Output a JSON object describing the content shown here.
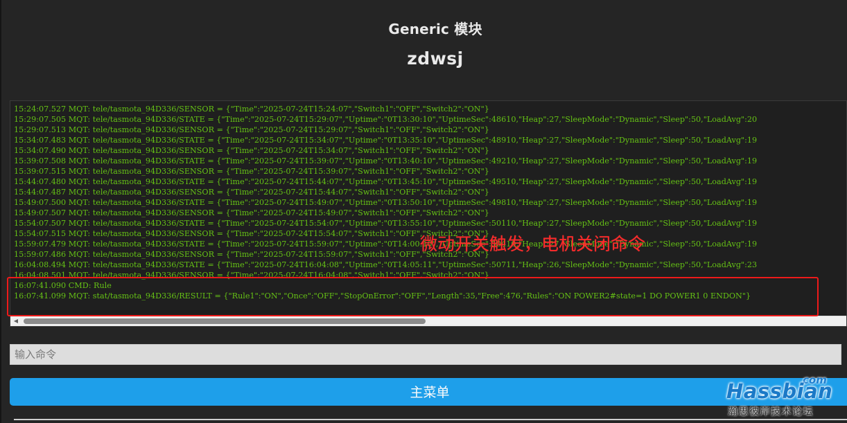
{
  "header": {
    "module_title": "Generic 模块",
    "device_name": "zdwsj"
  },
  "console": {
    "lines": [
      "15:24:07.527 MQT: tele/tasmota_94D336/SENSOR = {\"Time\":\"2025-07-24T15:24:07\",\"Switch1\":\"OFF\",\"Switch2\":\"ON\"}",
      "15:29:07.505 MQT: tele/tasmota_94D336/STATE = {\"Time\":\"2025-07-24T15:29:07\",\"Uptime\":\"0T13:30:10\",\"UptimeSec\":48610,\"Heap\":27,\"SleepMode\":\"Dynamic\",\"Sleep\":50,\"LoadAvg\":20",
      "15:29:07.513 MQT: tele/tasmota_94D336/SENSOR = {\"Time\":\"2025-07-24T15:29:07\",\"Switch1\":\"OFF\",\"Switch2\":\"ON\"}",
      "15:34:07.483 MQT: tele/tasmota_94D336/STATE = {\"Time\":\"2025-07-24T15:34:07\",\"Uptime\":\"0T13:35:10\",\"UptimeSec\":48910,\"Heap\":27,\"SleepMode\":\"Dynamic\",\"Sleep\":50,\"LoadAvg\":19",
      "15:34:07.490 MQT: tele/tasmota_94D336/SENSOR = {\"Time\":\"2025-07-24T15:34:07\",\"Switch1\":\"OFF\",\"Switch2\":\"ON\"}",
      "15:39:07.508 MQT: tele/tasmota_94D336/STATE = {\"Time\":\"2025-07-24T15:39:07\",\"Uptime\":\"0T13:40:10\",\"UptimeSec\":49210,\"Heap\":27,\"SleepMode\":\"Dynamic\",\"Sleep\":50,\"LoadAvg\":19",
      "15:39:07.515 MQT: tele/tasmota_94D336/SENSOR = {\"Time\":\"2025-07-24T15:39:07\",\"Switch1\":\"OFF\",\"Switch2\":\"ON\"}",
      "15:44:07.480 MQT: tele/tasmota_94D336/STATE = {\"Time\":\"2025-07-24T15:44:07\",\"Uptime\":\"0T13:45:10\",\"UptimeSec\":49510,\"Heap\":27,\"SleepMode\":\"Dynamic\",\"Sleep\":50,\"LoadAvg\":19",
      "15:44:07.487 MQT: tele/tasmota_94D336/SENSOR = {\"Time\":\"2025-07-24T15:44:07\",\"Switch1\":\"OFF\",\"Switch2\":\"ON\"}",
      "15:49:07.500 MQT: tele/tasmota_94D336/STATE = {\"Time\":\"2025-07-24T15:49:07\",\"Uptime\":\"0T13:50:10\",\"UptimeSec\":49810,\"Heap\":27,\"SleepMode\":\"Dynamic\",\"Sleep\":50,\"LoadAvg\":19",
      "15:49:07.507 MQT: tele/tasmota_94D336/SENSOR = {\"Time\":\"2025-07-24T15:49:07\",\"Switch1\":\"OFF\",\"Switch2\":\"ON\"}",
      "15:54:07.507 MQT: tele/tasmota_94D336/STATE = {\"Time\":\"2025-07-24T15:54:07\",\"Uptime\":\"0T13:55:10\",\"UptimeSec\":50110,\"Heap\":27,\"SleepMode\":\"Dynamic\",\"Sleep\":50,\"LoadAvg\":19",
      "15:54:07.515 MQT: tele/tasmota_94D336/SENSOR = {\"Time\":\"2025-07-24T15:54:07\",\"Switch1\":\"OFF\",\"Switch2\":\"ON\"}",
      "15:59:07.479 MQT: tele/tasmota_94D336/STATE = {\"Time\":\"2025-07-24T15:59:07\",\"Uptime\":\"0T14:00:10\",\"UptimeSec\":50410,\"Heap\":27,\"SleepMode\":\"Dynamic\",\"Sleep\":50,\"LoadAvg\":19",
      "15:59:07.486 MQT: tele/tasmota_94D336/SENSOR = {\"Time\":\"2025-07-24T15:59:07\",\"Switch1\":\"OFF\",\"Switch2\":\"ON\"}",
      "16:04:08.494 MQT: tele/tasmota_94D336/STATE = {\"Time\":\"2025-07-24T16:04:08\",\"Uptime\":\"0T14:05:11\",\"UptimeSec\":50711,\"Heap\":26,\"SleepMode\":\"Dynamic\",\"Sleep\":50,\"LoadAvg\":23",
      "16:04:08.501 MQT: tele/tasmota_94D336/SENSOR = {\"Time\":\"2025-07-24T16:04:08\",\"Switch1\":\"OFF\",\"Switch2\":\"ON\"}",
      "16:07:41.090 CMD: Rule",
      "16:07:41.099 MQT: stat/tasmota_94D336/RESULT = {\"Rule1\":\"ON\",\"Once\":\"OFF\",\"StopOnError\":\"OFF\",\"Length\":35,\"Free\":476,\"Rules\":\"ON POWER2#state=1 DO POWER1 0 ENDON\"}"
    ],
    "text_color": "#65c115"
  },
  "annotation": {
    "text": "微动开关触发，电机关闭命令",
    "color": "#ff2a2a"
  },
  "command": {
    "placeholder": "输入命令",
    "value": ""
  },
  "main_menu": {
    "label": "主菜单",
    "color": "#1e9fea"
  },
  "watermark": {
    "brand": "Hassbian",
    "suffix": "com",
    "subtitle": "瀚思彼岸技术论坛"
  }
}
